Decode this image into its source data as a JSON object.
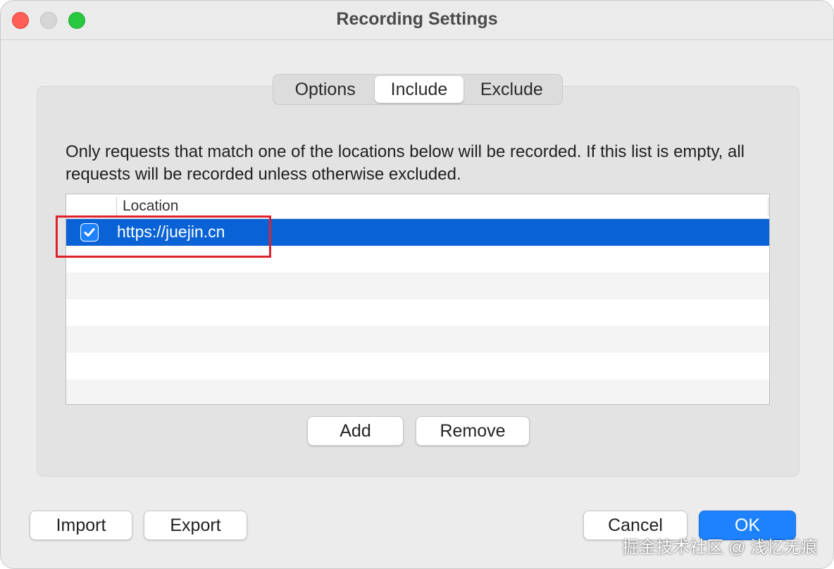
{
  "window": {
    "title": "Recording Settings"
  },
  "tabs": [
    {
      "label": "Options",
      "selected": false
    },
    {
      "label": "Include",
      "selected": true
    },
    {
      "label": "Exclude",
      "selected": false
    }
  ],
  "description": "Only requests that match one of the locations below will be recorded. If this list is empty, all requests will be recorded unless otherwise excluded.",
  "table": {
    "column_header": "Location",
    "rows": [
      {
        "checked": true,
        "location": "https://juejin.cn",
        "selected": true
      }
    ]
  },
  "list_buttons": {
    "add_label": "Add",
    "remove_label": "Remove"
  },
  "footer_buttons": {
    "import_label": "Import",
    "export_label": "Export",
    "cancel_label": "Cancel",
    "ok_label": "OK"
  },
  "watermark": "掘金技术社区 @ 浅忆无痕",
  "colors": {
    "accent": "#1e82ff",
    "selection": "#0a63d6",
    "highlight": "#e0202a"
  },
  "icons": {
    "checkbox": "checkmark-icon"
  }
}
